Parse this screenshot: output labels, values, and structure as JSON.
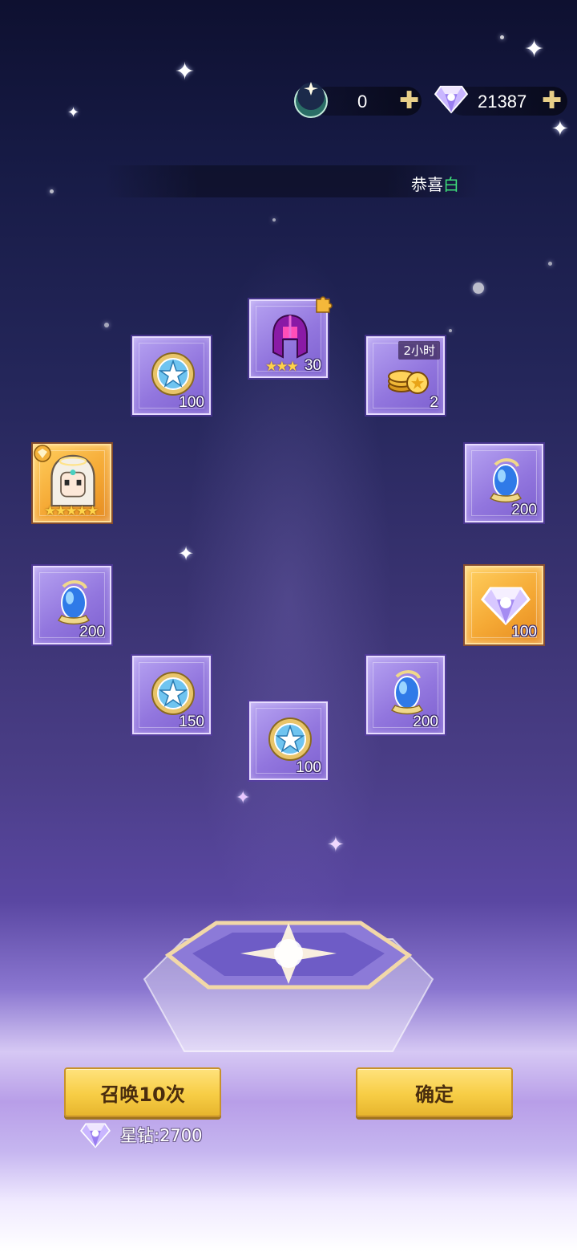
{
  "currencies": {
    "moon_token": {
      "value": "0",
      "icon": "crescent-moon-icon"
    },
    "star_diamond": {
      "value": "21387",
      "icon": "diamond-icon"
    },
    "plus_symbol": "✚"
  },
  "broadcast": {
    "prefix": "恭喜",
    "highlight": "白"
  },
  "rewards": [
    {
      "id": "card-1",
      "item": "equipment-helmet-shard",
      "quantity": "30",
      "stars": "★★★",
      "stars_count": 3,
      "badge": "puzzle-piece-icon",
      "rarity": "purple"
    },
    {
      "id": "card-2",
      "item": "star-medal",
      "quantity": "100",
      "rarity": "purple"
    },
    {
      "id": "card-3",
      "item": "gold-coins",
      "quantity": "2",
      "time_tag": "2小时",
      "rarity": "purple"
    },
    {
      "id": "card-4",
      "item": "hero-portrait",
      "stars": "★★★★★",
      "stars_count": 5,
      "badge": "hero-class-icon",
      "rarity": "gold"
    },
    {
      "id": "card-5",
      "item": "blue-crystal",
      "quantity": "200",
      "rarity": "purple"
    },
    {
      "id": "card-6",
      "item": "blue-crystal",
      "quantity": "200",
      "rarity": "purple"
    },
    {
      "id": "card-7",
      "item": "star-diamond",
      "quantity": "100",
      "rarity": "gold"
    },
    {
      "id": "card-8",
      "item": "star-medal",
      "quantity": "150",
      "rarity": "purple"
    },
    {
      "id": "card-9",
      "item": "blue-crystal",
      "quantity": "200",
      "rarity": "purple"
    },
    {
      "id": "card-10",
      "item": "star-medal",
      "quantity": "100",
      "rarity": "purple"
    }
  ],
  "buttons": {
    "summon_ten": "召唤10次",
    "confirm": "确定"
  },
  "cost": {
    "text": "星钻:2700",
    "icon": "diamond-icon"
  },
  "colors": {
    "button_gold": "#f7cd45",
    "card_purple": "#9276de",
    "card_gold": "#f5a935",
    "highlight_green": "#3ee07a"
  }
}
